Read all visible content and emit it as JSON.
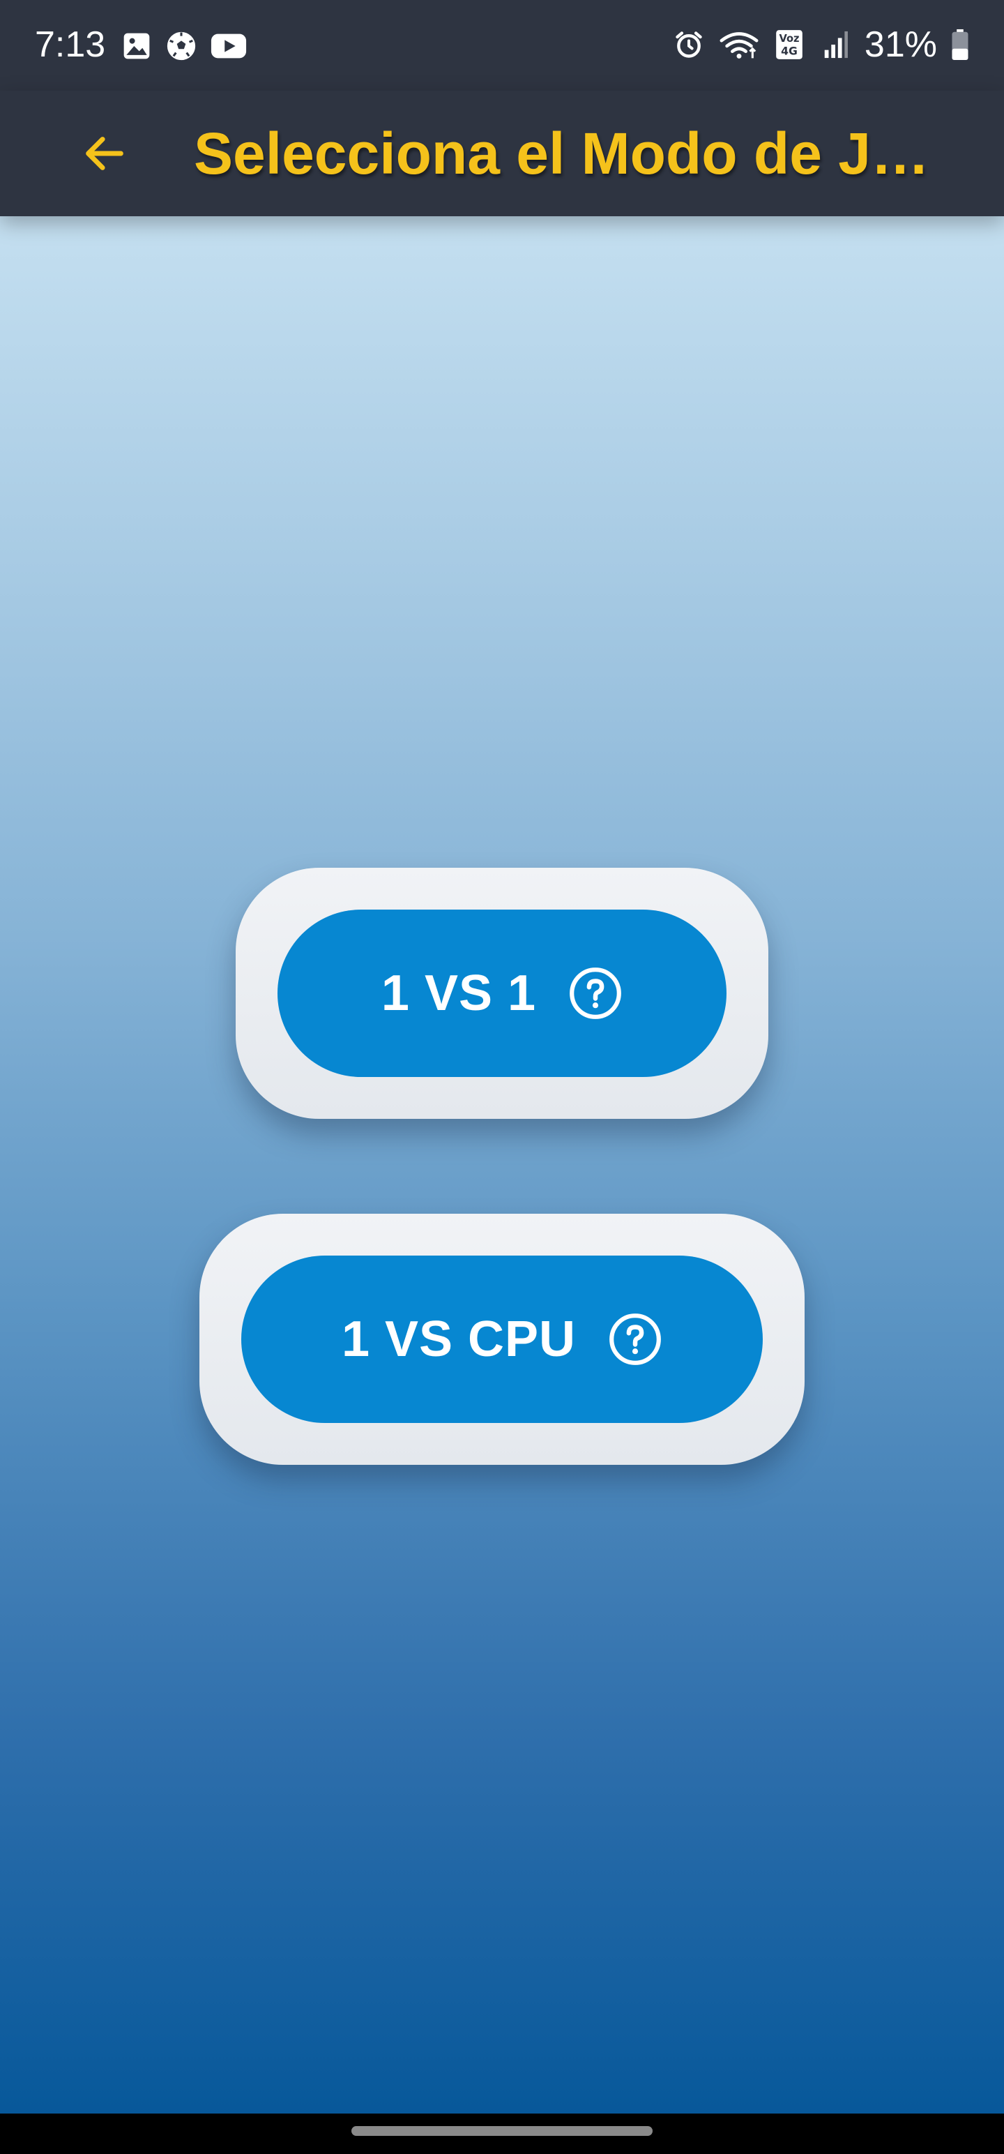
{
  "status_bar": {
    "time": "7:13",
    "left_icons": [
      "gallery-icon",
      "soccer-ball-icon",
      "youtube-icon"
    ],
    "right_icons": [
      "alarm-icon",
      "wifi-icon",
      "volte-4g-icon",
      "signal-icon",
      "battery-icon"
    ],
    "battery_percent": "31%"
  },
  "app_bar": {
    "title": "Selecciona el Modo de J…",
    "back_icon": "arrow-left-icon",
    "title_color": "#f5c21b",
    "background": "#2e3441"
  },
  "modes": [
    {
      "label": "1 VS 1",
      "help_icon": "help-circle-icon"
    },
    {
      "label": "1 VS CPU",
      "help_icon": "help-circle-icon"
    }
  ],
  "colors": {
    "button_blue": "#0787d1",
    "card_background": "#eef1f4",
    "gradient_top": "#c4dff0",
    "gradient_bottom": "#07589a"
  }
}
